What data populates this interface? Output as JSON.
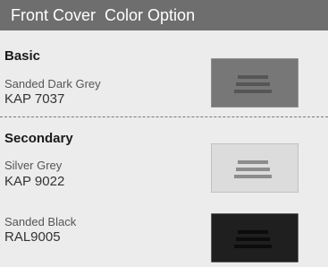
{
  "header": {
    "title": "Front Cover  Color Option"
  },
  "basic": {
    "heading": "Basic",
    "items": [
      {
        "name": "Sanded Dark Grey",
        "code": "KAP 7037",
        "color": "#777777",
        "slot": "#565656"
      }
    ]
  },
  "secondary": {
    "heading": "Secondary",
    "items": [
      {
        "name": "Silver Grey",
        "code": "KAP 9022",
        "color": "#dcdcdc",
        "slot": "#8c8c8c"
      },
      {
        "name": "Sanded Black",
        "code": "RAL9005",
        "color": "#1f1f1f",
        "slot": "#0c0c0c"
      }
    ]
  }
}
